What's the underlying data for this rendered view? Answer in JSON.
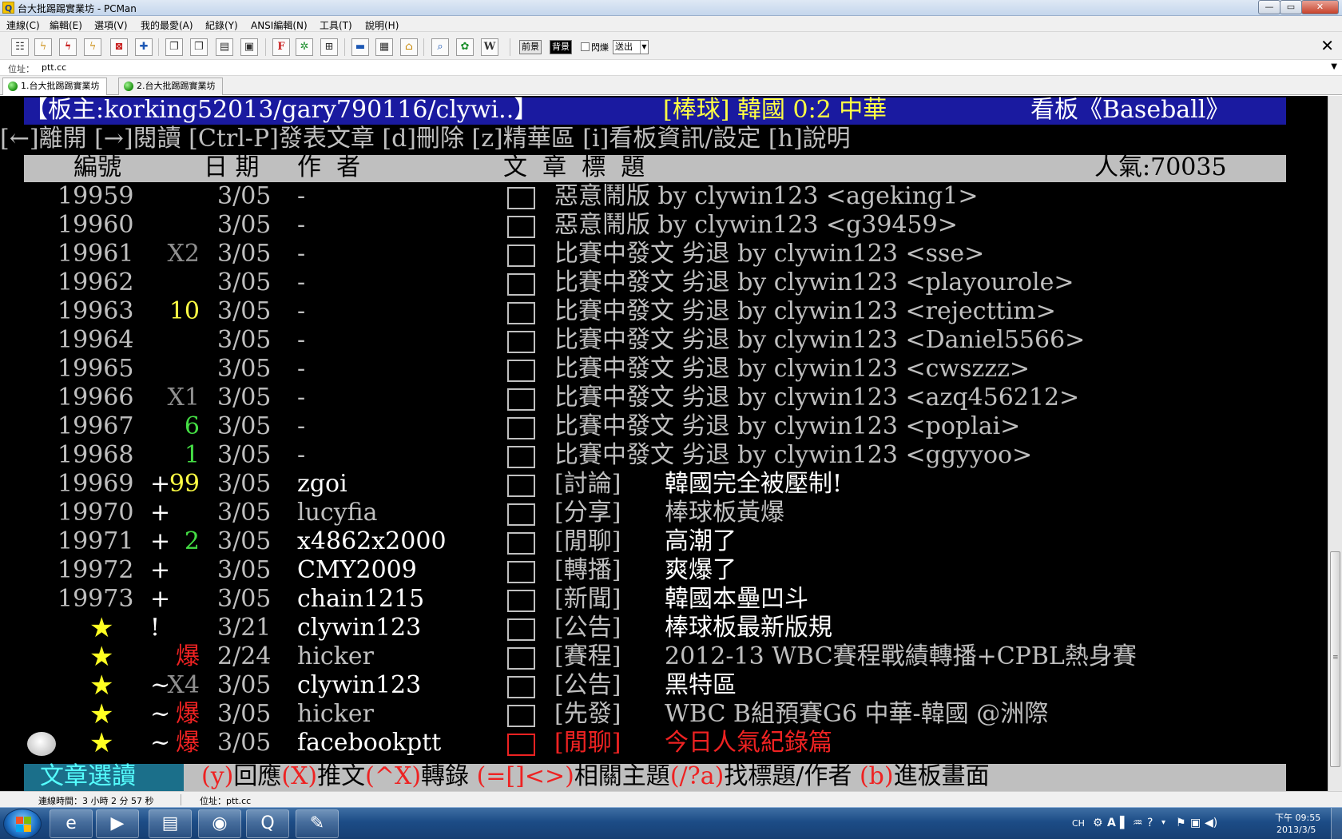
{
  "window": {
    "app_icon": "Q",
    "title": "台大批踢踢實業坊 - PCMan",
    "controls": {
      "minimize": "—",
      "maximize": "▭",
      "close": "✕"
    }
  },
  "menu": [
    "連線(C)",
    "編輯(E)",
    "選項(V)",
    "我的最愛(A)",
    "紀錄(Y)",
    "ANSI編輯(N)",
    "工具(T)",
    "說明(H)"
  ],
  "toolbar": {
    "fg_label": "前景",
    "bg_label": "背景",
    "blink_label": "閃爍",
    "send_select": "送出",
    "close": "✕"
  },
  "address": {
    "label": "位址：",
    "value": "ptt.cc"
  },
  "tabs": [
    {
      "label": "1.台大批踢踢實業坊",
      "active": true
    },
    {
      "label": "2.台大批踢踢實業坊",
      "active": false
    }
  ],
  "board": {
    "header_left": "【板主:korking52013/gary790116/clywi..】",
    "header_mid": "[棒球] 韓國 0:2 中華",
    "header_right": "看板《Baseball》",
    "help_line": "[←]離開 [→]閱讀 [Ctrl-P]發表文章 [d]刪除 [z]精華區 [i]看板資訊/設定 [h]說明",
    "columns": {
      "num": "編號",
      "date": "日 期",
      "author": "作  者",
      "title": "文  章  標  題"
    },
    "popularity": "人氣:70035",
    "footer_mode": "文章選讀",
    "footer_keys": [
      {
        "text": "(y)",
        "color": "rd"
      },
      {
        "text": "回應",
        "color": "bk"
      },
      {
        "text": "(X)",
        "color": "rd"
      },
      {
        "text": "推文",
        "color": "bk"
      },
      {
        "text": "(^X)",
        "color": "rd"
      },
      {
        "text": "轉錄 ",
        "color": "bk"
      },
      {
        "text": "(=[]<>)",
        "color": "rd"
      },
      {
        "text": "相關主題",
        "color": "bk"
      },
      {
        "text": "(/?a)",
        "color": "rd"
      },
      {
        "text": "找標題/作者 ",
        "color": "bk"
      },
      {
        "text": "(b)",
        "color": "rd"
      },
      {
        "text": "進板畫面",
        "color": "bk"
      }
    ]
  },
  "posts": [
    {
      "num": "19959",
      "mark": "",
      "push": "",
      "push_color": "g",
      "date": "3/05",
      "author": "-",
      "author_color": "g",
      "tag": "",
      "title": "惡意鬧版 by clywin123 <ageking1>",
      "title_color": "g"
    },
    {
      "num": "19960",
      "mark": "",
      "push": "",
      "push_color": "g",
      "date": "3/05",
      "author": "-",
      "author_color": "g",
      "tag": "",
      "title": "惡意鬧版 by clywin123 <g39459>",
      "title_color": "g"
    },
    {
      "num": "19961",
      "mark": "",
      "push": "X2",
      "push_color": "dg",
      "date": "3/05",
      "author": "-",
      "author_color": "g",
      "tag": "",
      "title": "比賽中發文 劣退 by clywin123 <sse>",
      "title_color": "g"
    },
    {
      "num": "19962",
      "mark": "",
      "push": "",
      "push_color": "g",
      "date": "3/05",
      "author": "-",
      "author_color": "g",
      "tag": "",
      "title": "比賽中發文 劣退 by clywin123 <playourole>",
      "title_color": "g"
    },
    {
      "num": "19963",
      "mark": "",
      "push": "10",
      "push_color": "y",
      "date": "3/05",
      "author": "-",
      "author_color": "g",
      "tag": "",
      "title": "比賽中發文 劣退 by clywin123 <rejecttim>",
      "title_color": "g"
    },
    {
      "num": "19964",
      "mark": "",
      "push": "",
      "push_color": "g",
      "date": "3/05",
      "author": "-",
      "author_color": "g",
      "tag": "",
      "title": "比賽中發文 劣退 by clywin123 <Daniel5566>",
      "title_color": "g"
    },
    {
      "num": "19965",
      "mark": "",
      "push": "",
      "push_color": "g",
      "date": "3/05",
      "author": "-",
      "author_color": "g",
      "tag": "",
      "title": "比賽中發文 劣退 by clywin123 <cwszzz>",
      "title_color": "g"
    },
    {
      "num": "19966",
      "mark": "",
      "push": "X1",
      "push_color": "dg",
      "date": "3/05",
      "author": "-",
      "author_color": "g",
      "tag": "",
      "title": "比賽中發文 劣退 by clywin123 <azq456212>",
      "title_color": "g"
    },
    {
      "num": "19967",
      "mark": "",
      "push": "6",
      "push_color": "gr",
      "date": "3/05",
      "author": "-",
      "author_color": "g",
      "tag": "",
      "title": "比賽中發文 劣退 by clywin123 <poplai>",
      "title_color": "g"
    },
    {
      "num": "19968",
      "mark": "",
      "push": "1",
      "push_color": "gr",
      "date": "3/05",
      "author": "-",
      "author_color": "g",
      "tag": "",
      "title": "比賽中發文 劣退 by clywin123 <ggyyoo>",
      "title_color": "g"
    },
    {
      "num": "19969",
      "mark": "+",
      "push": "99",
      "push_color": "y",
      "date": "3/05",
      "author": "zgoi",
      "author_color": "w",
      "tag": "[討論]",
      "title": "韓國完全被壓制!",
      "title_color": "w"
    },
    {
      "num": "19970",
      "mark": "+",
      "push": "",
      "push_color": "g",
      "date": "3/05",
      "author": "lucyfia",
      "author_color": "g",
      "tag": "[分享]",
      "title": "棒球板黃爆",
      "title_color": "g"
    },
    {
      "num": "19971",
      "mark": "+",
      "push": "2",
      "push_color": "gr",
      "date": "3/05",
      "author": "x4862x2000",
      "author_color": "w",
      "tag": "[閒聊]",
      "title": "高潮了",
      "title_color": "w"
    },
    {
      "num": "19972",
      "mark": "+",
      "push": "",
      "push_color": "g",
      "date": "3/05",
      "author": "CMY2009",
      "author_color": "w",
      "tag": "[轉播]",
      "title": "爽爆了",
      "title_color": "w"
    },
    {
      "num": "19973",
      "mark": "+",
      "push": "",
      "push_color": "g",
      "date": "3/05",
      "author": "chain1215",
      "author_color": "w",
      "tag": "[新聞]",
      "title": "韓國本壘凹斗",
      "title_color": "w"
    },
    {
      "num": "★",
      "mark": "!",
      "push": "",
      "push_color": "g",
      "date": "3/21",
      "author": "clywin123",
      "author_color": "w",
      "tag": "[公告]",
      "title": "棒球板最新版規",
      "title_color": "w"
    },
    {
      "num": "★",
      "mark": "",
      "push": "爆",
      "push_color": "rd",
      "date": "2/24",
      "author": "hicker",
      "author_color": "g",
      "tag": "[賽程]",
      "title": "2012-13 WBC賽程戰績轉播+CPBL熱身賽",
      "title_color": "g"
    },
    {
      "num": "★",
      "mark": "~",
      "push": "X4",
      "push_color": "dg",
      "date": "3/05",
      "author": "clywin123",
      "author_color": "w",
      "tag": "[公告]",
      "title": "黑特區",
      "title_color": "w"
    },
    {
      "num": "★",
      "mark": "~",
      "push": "爆",
      "push_color": "rd",
      "date": "3/05",
      "author": "hicker",
      "author_color": "g",
      "tag": "[先發]",
      "title": "WBC B組預賽G6 中華-韓國 @洲際",
      "title_color": "g"
    },
    {
      "num": "★",
      "mark": "~",
      "push": "爆",
      "push_color": "rd",
      "date": "3/05",
      "author": "facebookptt",
      "author_color": "w",
      "tag": "[閒聊]",
      "title": "今日人氣紀錄篇",
      "title_color": "rd",
      "tag_color": "rd",
      "box_color": "red"
    }
  ],
  "status": {
    "connection_time": "連線時間：3 小時 2 分 57 秒",
    "address": "位址：ptt.cc"
  },
  "taskbar": {
    "items": [
      {
        "icon": "ie-icon",
        "glyph": "e"
      },
      {
        "icon": "media-player-icon",
        "glyph": "▶"
      },
      {
        "icon": "explorer-icon",
        "glyph": "▤"
      },
      {
        "icon": "firefox-icon",
        "glyph": "◉"
      },
      {
        "icon": "pcman-icon",
        "glyph": "Q"
      },
      {
        "icon": "paint-icon",
        "glyph": "✎"
      }
    ],
    "lang": "CH",
    "clock_time": "下午 09:55",
    "clock_date": "2013/3/5"
  }
}
